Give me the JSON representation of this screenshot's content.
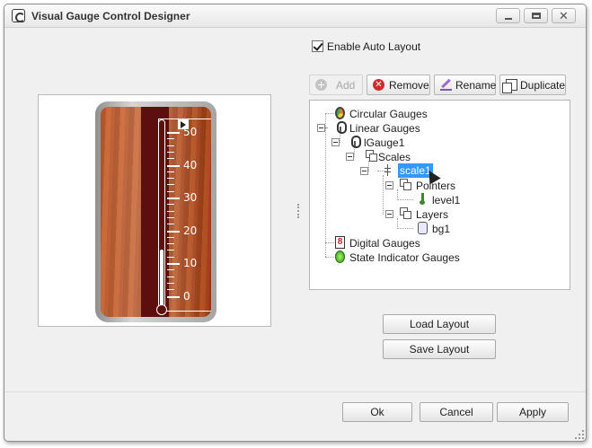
{
  "window": {
    "title": "Visual Gauge Control Designer"
  },
  "options": {
    "auto_layout_label": "Enable Auto Layout",
    "auto_layout_checked": true
  },
  "toolbar": {
    "add": "Add",
    "remove": "Remove",
    "rename": "Rename",
    "duplicate": "Duplicate"
  },
  "tree": {
    "circular": "Circular Gauges",
    "linear": "Linear Gauges",
    "lgauge": "lGauge1",
    "scales": "Scales",
    "scale1": "scale1",
    "pointers": "Pointers",
    "level1": "level1",
    "layers": "Layers",
    "bg1": "bg1",
    "digital": "Digital Gauges",
    "state": "State Indicator Gauges",
    "digital_glyph": "8"
  },
  "layout": {
    "load": "Load Layout",
    "save": "Save Layout"
  },
  "footer": {
    "ok": "Ok",
    "cancel": "Cancel",
    "apply": "Apply"
  },
  "gauge": {
    "labels": [
      "50",
      "40",
      "30",
      "20",
      "10",
      "0"
    ],
    "level_fraction": 0.32
  },
  "colors": {
    "selection": "#3399ff",
    "gauge_body": "#b0461a"
  }
}
